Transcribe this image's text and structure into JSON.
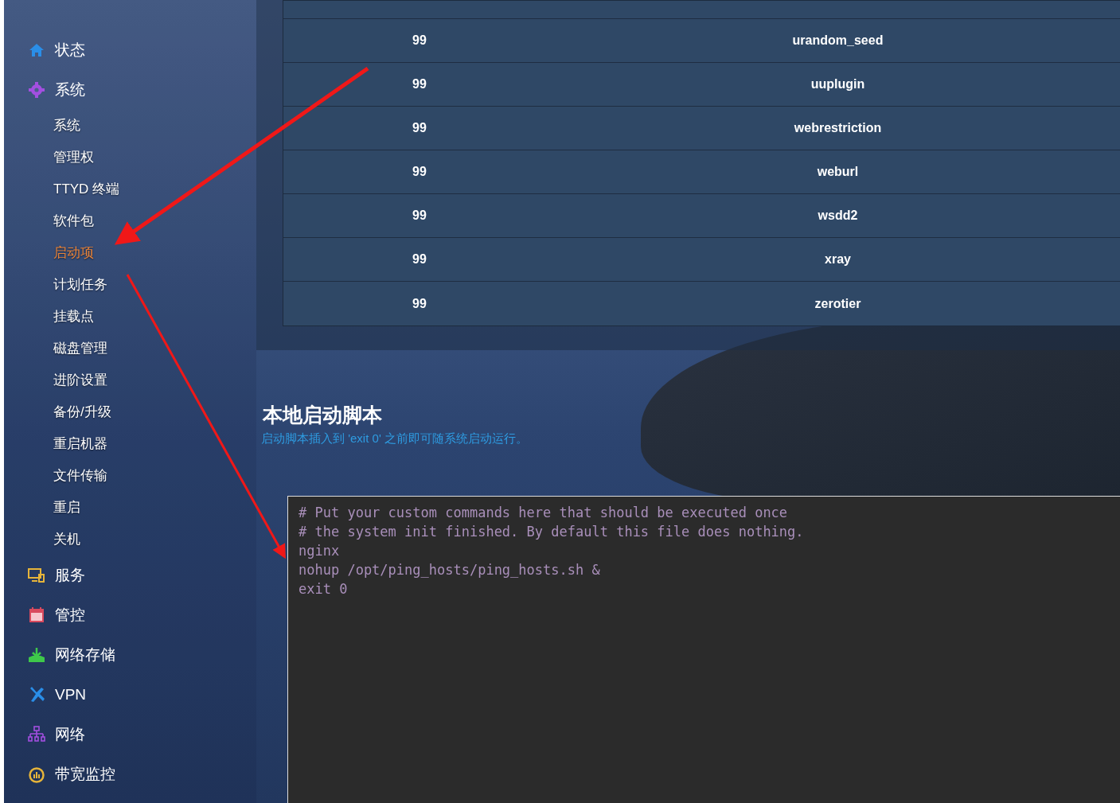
{
  "sidebar": {
    "items": [
      {
        "label": "状态",
        "selected": false
      },
      {
        "label": "系统",
        "selected": false,
        "children": [
          {
            "label": "系统",
            "selected": false
          },
          {
            "label": "管理权",
            "selected": false
          },
          {
            "label": "TTYD 终端",
            "selected": false
          },
          {
            "label": "软件包",
            "selected": false
          },
          {
            "label": "启动项",
            "selected": true
          },
          {
            "label": "计划任务",
            "selected": false
          },
          {
            "label": "挂载点",
            "selected": false
          },
          {
            "label": "磁盘管理",
            "selected": false
          },
          {
            "label": "进阶设置",
            "selected": false
          },
          {
            "label": "备份/升级",
            "selected": false
          },
          {
            "label": "重启机器",
            "selected": false
          },
          {
            "label": "文件传输",
            "selected": false
          },
          {
            "label": "重启",
            "selected": false
          },
          {
            "label": "关机",
            "selected": false
          }
        ]
      },
      {
        "label": "服务",
        "selected": false
      },
      {
        "label": "管控",
        "selected": false
      },
      {
        "label": "网络存储",
        "selected": false
      },
      {
        "label": "VPN",
        "selected": false
      },
      {
        "label": "网络",
        "selected": false
      },
      {
        "label": "带宽监控",
        "selected": false
      }
    ]
  },
  "startup_table": {
    "rows": [
      {
        "priority": "99",
        "name": "urandom_seed"
      },
      {
        "priority": "99",
        "name": "uuplugin"
      },
      {
        "priority": "99",
        "name": "webrestriction"
      },
      {
        "priority": "99",
        "name": "weburl"
      },
      {
        "priority": "99",
        "name": "wsdd2"
      },
      {
        "priority": "99",
        "name": "xray"
      },
      {
        "priority": "99",
        "name": "zerotier"
      }
    ]
  },
  "local_startup": {
    "title": "本地启动脚本",
    "description": "启动脚本插入到 'exit 0' 之前即可随系统启动运行。",
    "script": "# Put your custom commands here that should be executed once\n# the system init finished. By default this file does nothing.\nnginx\nnohup /opt/ping_hosts/ping_hosts.sh &\nexit 0"
  }
}
